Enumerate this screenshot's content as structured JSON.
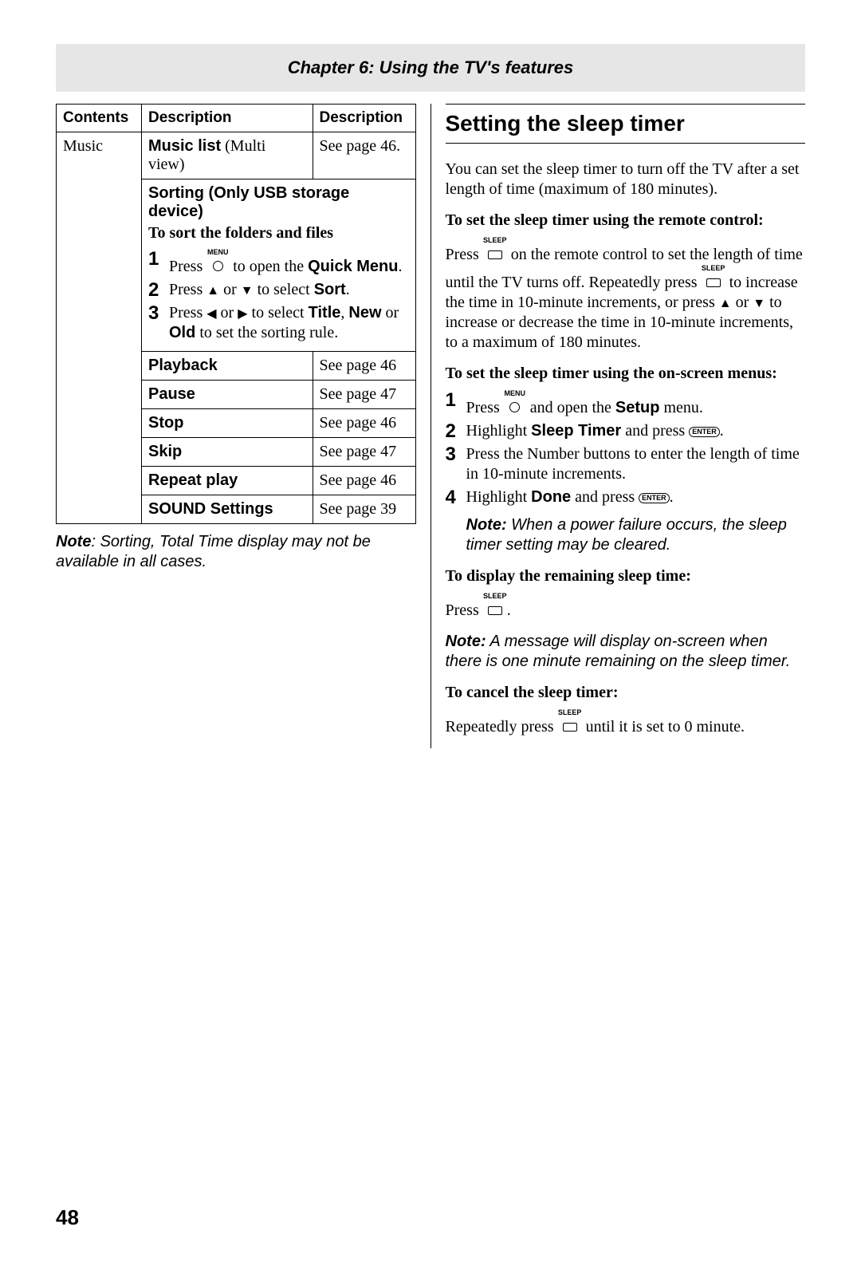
{
  "chapter_title": "Chapter 6: Using the TV's features",
  "table": {
    "head": {
      "c1": "Contents",
      "c2": "Description",
      "c3": "Description"
    },
    "music_label": "Music",
    "music_list_bold": "Music list",
    "music_list_paren": " (Multi view)",
    "music_list_ref": "See page 46.",
    "sorting_head": "Sorting (Only USB storage device)",
    "sort_sub": "To sort the folders and files",
    "step1_a": "Press ",
    "step1_b": " to open the ",
    "step1_c": "Quick Menu",
    "step1_d": ".",
    "step2_a": "Press ",
    "step2_b": " or ",
    "step2_c": " to select ",
    "step2_d": "Sort",
    "step2_e": ".",
    "step3_a": "Press ",
    "step3_b": " or ",
    "step3_c": " to select ",
    "step3_d": "Title",
    "step3_e": ", ",
    "step3_f": "New",
    "step3_g": " or ",
    "step3_h": "Old",
    "step3_i": " to set the sorting rule.",
    "rows": [
      {
        "label": "Playback",
        "ref": "See page 46"
      },
      {
        "label": "Pause",
        "ref": "See page 47"
      },
      {
        "label": "Stop",
        "ref": "See page 46"
      },
      {
        "label": "Skip",
        "ref": "See page 47"
      },
      {
        "label": "Repeat play",
        "ref": "See page 46"
      },
      {
        "label": "SOUND Settings",
        "ref": "See page 39"
      }
    ]
  },
  "left_note_bold": "Note",
  "left_note_rest": ": Sorting, Total Time display may not be available in all cases.",
  "right": {
    "section_title": "Setting the sleep timer",
    "intro": "You can set the sleep timer to turn off the TV after a set length of time (maximum of 180 minutes).",
    "h_remote": "To set the sleep timer using the remote control:",
    "remote_a": "Press ",
    "remote_b": " on the remote control to set the length of time until the TV turns off. Repeatedly press ",
    "remote_c": " to increase the time in 10-minute increments, or press ",
    "remote_d": " or ",
    "remote_e": " to increase or decrease the time in 10-minute increments, to a maximum of 180 minutes.",
    "h_menus": "To set the sleep timer using the on-screen menus:",
    "m1_a": "Press ",
    "m1_b": " and open the ",
    "m1_c": "Setup",
    "m1_d": " menu.",
    "m2_a": "Highlight ",
    "m2_b": "Sleep Timer",
    "m2_c": " and press ",
    "m2_d": ".",
    "m3": "Press the Number buttons to enter the length of time in 10-minute increments.",
    "m4_a": "Highlight ",
    "m4_b": "Done",
    "m4_c": " and press ",
    "m4_d": ".",
    "note1_bold": "Note:",
    "note1_rest": " When a power failure occurs, the sleep timer setting may be cleared.",
    "h_display": "To display the remaining sleep time:",
    "display_a": "Press ",
    "display_b": ".",
    "note2_bold": "Note:",
    "note2_rest": " A message will display on-screen when there is one minute remaining on the sleep timer.",
    "h_cancel": "To cancel the sleep timer:",
    "cancel_a": "Repeatedly press ",
    "cancel_b": " until it is set to 0 minute."
  },
  "icons": {
    "menu_label": "MENU",
    "sleep_label": "SLEEP",
    "enter_label": "ENTER",
    "tri_up": "▲",
    "tri_down": "▼",
    "tri_left": "◀",
    "tri_right": "▶"
  },
  "page_number": "48"
}
